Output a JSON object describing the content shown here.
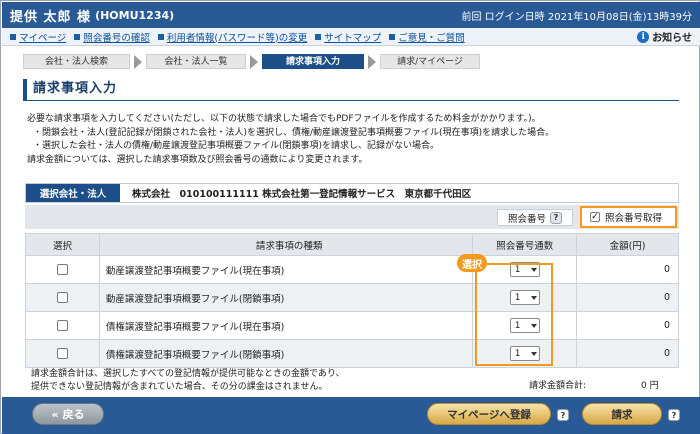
{
  "header": {
    "user_name": "提供 太郎 様",
    "user_id": "(HOMU1234)",
    "last_login": "前回 ログイン日時 2021年10月08日(金)13時39分"
  },
  "nav": {
    "links": [
      "マイページ",
      "照会番号の確認",
      "利用者情報(パスワード等)の変更",
      "サイトマップ",
      "ご意見・ご質問"
    ],
    "notice_label": "お知らせ",
    "notice_icon": "info-icon"
  },
  "steps": [
    "会社・法人検索",
    "会社・法人一覧",
    "請求事項入力",
    "請求/マイページ"
  ],
  "page_title": "請求事項入力",
  "description": [
    "必要な請求事項を入力してください(ただし、以下の状態で請求した場合でもPDFファイルを作成するため料金がかかります。)。",
    "・閉鎖会社・法人(登記記録が閉鎖された会社・法人)を選択し、債権/動産譲渡登記事項概要ファイル(現在事項)を請求した場合。",
    "・選択した会社・法人の債権/動産譲渡登記事項概要ファイル(閉鎖事項)を請求し、記録がない場合。",
    "請求金額については、選択した請求事項数及び照会番号の通数により変更されます。"
  ],
  "company": {
    "label": "選択会社・法人",
    "value": "株式会社　010100111111 株式会社第一登記情報サービス　東京都千代田区"
  },
  "inquiry": {
    "label": "照会番号",
    "help": "?",
    "checkbox_label": "照会番号取得",
    "checked_mark": "✓"
  },
  "table": {
    "headers": [
      "選択",
      "請求事項の種類",
      "照会番号通数",
      "金額(円)"
    ],
    "rows": [
      {
        "type": "動産譲渡登記事項概要ファイル(現在事項)",
        "count": "1",
        "amount": "0"
      },
      {
        "type": "動産譲渡登記事項概要ファイル(閉鎖事項)",
        "count": "1",
        "amount": "0"
      },
      {
        "type": "債権譲渡登記事項概要ファイル(現在事項)",
        "count": "1",
        "amount": "0"
      },
      {
        "type": "債権譲渡登記事項概要ファイル(閉鎖事項)",
        "count": "1",
        "amount": "0"
      }
    ]
  },
  "select_badge": "選択",
  "footer": {
    "note_line1": "請求金額合計は、選択したすべての登記情報が提供可能なときの金額であり、",
    "note_line2": "提供できない登記情報が含まれていた場合、その分の課金はされません。",
    "total_label": "請求金額合計:",
    "total_value": "0 円"
  },
  "buttons": {
    "back": "戻る",
    "back_icon": "«",
    "mypage": "マイページへ登録",
    "request": "請求",
    "help": "?"
  },
  "colors": {
    "header_bg": "#2a5a96",
    "accent_orange": "#f39a1e",
    "step_active": "#1c4f8a"
  }
}
